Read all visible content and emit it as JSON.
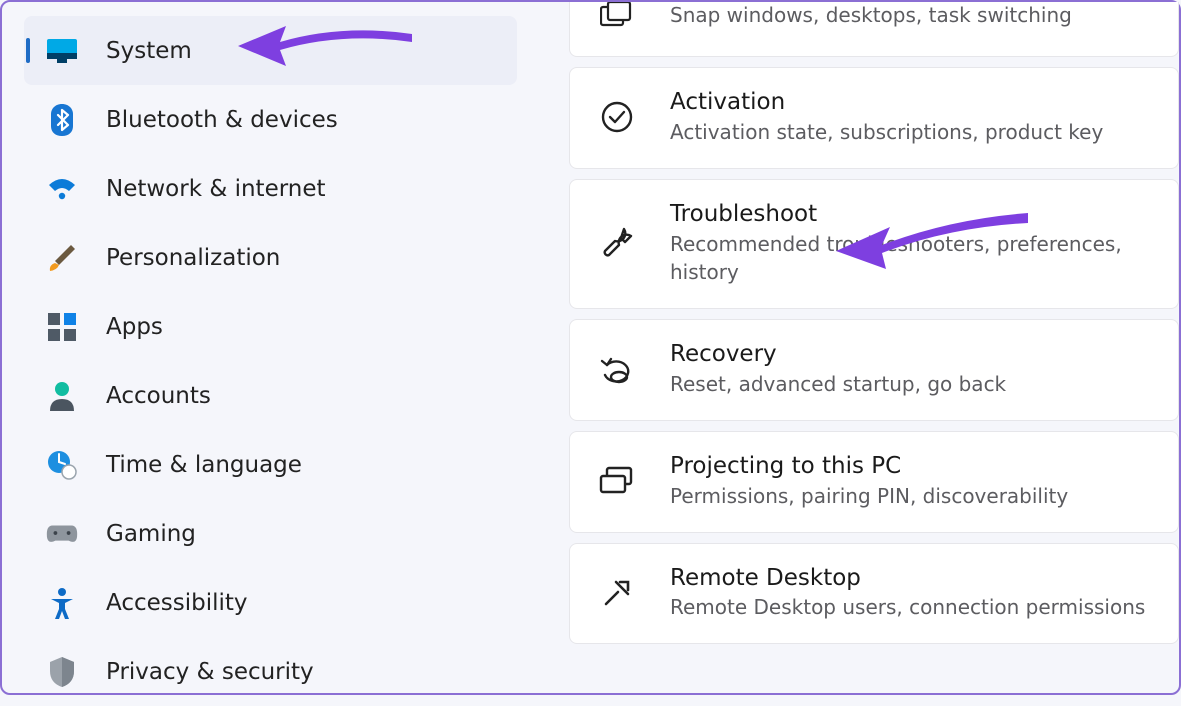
{
  "sidebar": {
    "items": [
      {
        "label": "System",
        "icon": "system"
      },
      {
        "label": "Bluetooth & devices",
        "icon": "bluetooth"
      },
      {
        "label": "Network & internet",
        "icon": "wifi"
      },
      {
        "label": "Personalization",
        "icon": "brush"
      },
      {
        "label": "Apps",
        "icon": "apps"
      },
      {
        "label": "Accounts",
        "icon": "account"
      },
      {
        "label": "Time & language",
        "icon": "clock"
      },
      {
        "label": "Gaming",
        "icon": "gamepad"
      },
      {
        "label": "Accessibility",
        "icon": "accessibility"
      },
      {
        "label": "Privacy & security",
        "icon": "shield"
      }
    ]
  },
  "main": {
    "cards": [
      {
        "title": "",
        "sub": "Snap windows, desktops, task switching",
        "icon": "multitask"
      },
      {
        "title": "Activation",
        "sub": "Activation state, subscriptions, product key",
        "icon": "check"
      },
      {
        "title": "Troubleshoot",
        "sub": "Recommended troubleshooters, preferences, history",
        "icon": "wrench"
      },
      {
        "title": "Recovery",
        "sub": "Reset, advanced startup, go back",
        "icon": "recovery"
      },
      {
        "title": "Projecting to this PC",
        "sub": "Permissions, pairing PIN, discoverability",
        "icon": "project"
      },
      {
        "title": "Remote Desktop",
        "sub": "Remote Desktop users, connection permissions",
        "icon": "remote"
      }
    ]
  }
}
